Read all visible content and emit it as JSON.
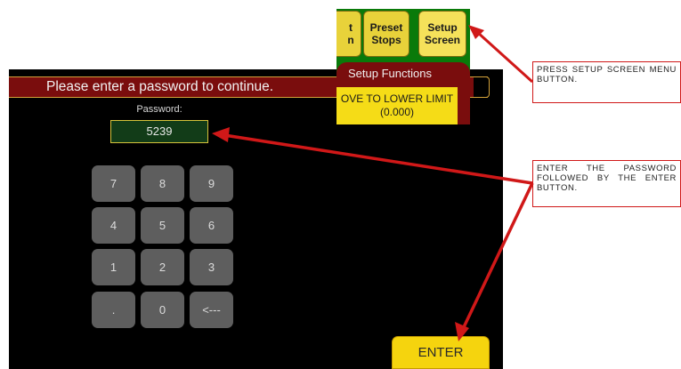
{
  "banner_text": "Please enter a password to continue.",
  "password": {
    "label": "Password:",
    "value": "5239"
  },
  "keypad": [
    "7",
    "8",
    "9",
    "4",
    "5",
    "6",
    "1",
    "2",
    "3",
    ".",
    "0",
    "<---"
  ],
  "enter_label": "ENTER",
  "setup_menu": {
    "tab_partial_1": "t",
    "tab_partial_2": "n",
    "preset_stops": "Preset Stops",
    "setup_screen": "Setup Screen",
    "title": "Setup Functions",
    "move_lower_line1": "OVE TO LOWER LIMIT",
    "move_lower_line2": "(0.000)"
  },
  "callouts": {
    "step1": "PRESS SETUP SCREEN MENU BUTTON.",
    "step2": "ENTER THE PASSWORD FOLLOWED BY THE ENTER BUTTON."
  },
  "colors": {
    "banner": "#7a0d0d",
    "key": "#5e5e5e",
    "enter": "#f5d40e",
    "arrow": "#d01818",
    "input_bg": "#123c18"
  }
}
